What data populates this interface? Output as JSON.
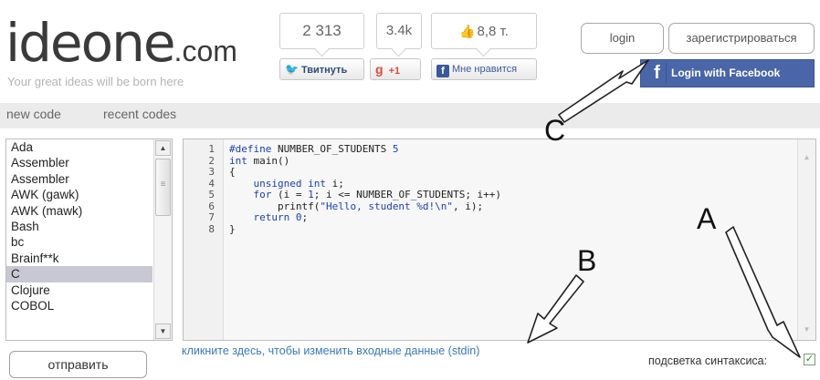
{
  "logo": {
    "main": "ideone",
    "suffix": ".com",
    "tagline": "Your great ideas will be born here"
  },
  "social": {
    "twitter_count": "2 313",
    "gplus_count": "3.4k",
    "fb_count": "8,8 т.",
    "twitter_label": "Твитнуть",
    "gplus_label": "+1",
    "fb_like_label": "Мне нравится"
  },
  "auth": {
    "login_label": "login",
    "register_label": "зарегистрироваться",
    "facebook_label": "Login with Facebook"
  },
  "nav": {
    "new_code": "new code",
    "recent_codes": "recent codes"
  },
  "languages": {
    "items": [
      "Ada",
      "Assembler",
      "Assembler",
      "AWK (gawk)",
      "AWK (mawk)",
      "Bash",
      "bc",
      "Brainf**k",
      "C",
      "Clojure",
      "COBOL"
    ],
    "selected": "C"
  },
  "code": {
    "lines": [
      {
        "n": "1",
        "text": "#define NUMBER_OF_STUDENTS 5"
      },
      {
        "n": "2",
        "text": "int main()"
      },
      {
        "n": "3",
        "text": "{"
      },
      {
        "n": "4",
        "text": "    unsigned int i;"
      },
      {
        "n": "5",
        "text": "    for (i = 1; i <= NUMBER_OF_STUDENTS; i++)"
      },
      {
        "n": "6",
        "text": "        printf(\"Hello, student %d!\\n\", i);"
      },
      {
        "n": "7",
        "text": "    return 0;"
      },
      {
        "n": "8",
        "text": "}"
      }
    ]
  },
  "bottom": {
    "submit_label": "отправить",
    "stdin_link": "кликните здесь, чтобы изменить входные данные (stdin)",
    "syntax_label": "подсветка синтаксиса:",
    "syntax_checked": true
  },
  "annotations": {
    "a": "A",
    "b": "B",
    "c": "C"
  },
  "colors": {
    "facebook": "#4a66a8",
    "link": "#3a78b8",
    "selected": "#c8c8d4",
    "keyword": "#1a3fb5"
  }
}
